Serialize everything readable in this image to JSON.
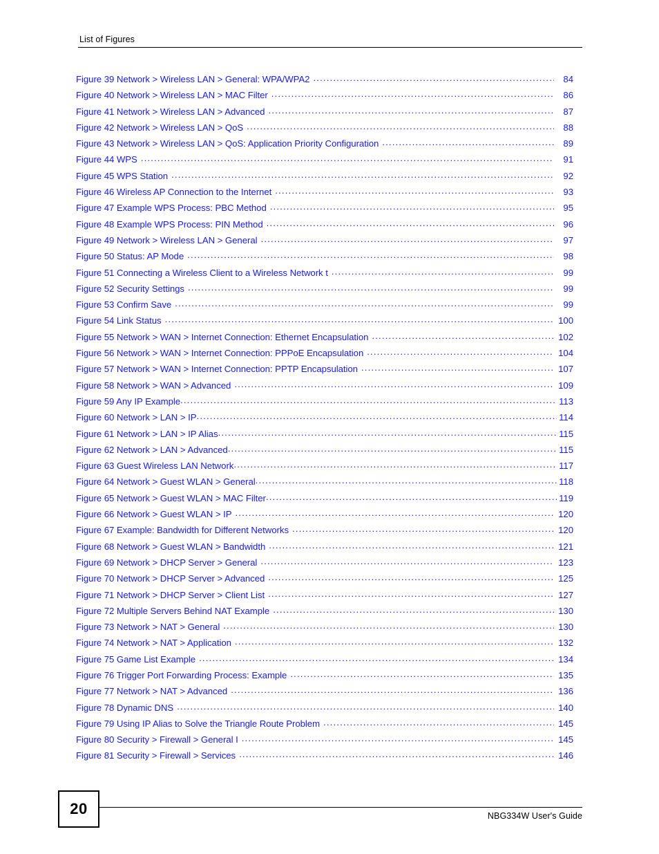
{
  "header": {
    "title": "List of Figures"
  },
  "footer": {
    "page_number": "20",
    "guide_title": "NBG334W User's Guide"
  },
  "colors": {
    "link_blue": "#1a1ae6",
    "text_black": "#000000",
    "background": "#ffffff"
  },
  "toc": {
    "entries": [
      {
        "label": "Figure 39 Network > Wireless LAN > General: WPA/WPA2",
        "page": "84",
        "tight": false
      },
      {
        "label": "Figure 40 Network > Wireless LAN > MAC Filter",
        "page": "86",
        "tight": false
      },
      {
        "label": "Figure 41 Network > Wireless LAN > Advanced",
        "page": "87",
        "tight": false
      },
      {
        "label": "Figure 42 Network > Wireless LAN > QoS",
        "page": "88",
        "tight": false
      },
      {
        "label": "Figure 43 Network > Wireless LAN > QoS: Application Priority Configuration",
        "page": "89",
        "tight": false
      },
      {
        "label": "Figure 44 WPS",
        "page": "91",
        "tight": false
      },
      {
        "label": "Figure 45 WPS Station",
        "page": "92",
        "tight": false
      },
      {
        "label": "Figure 46 Wireless AP Connection to the Internet",
        "page": "93",
        "tight": false
      },
      {
        "label": "Figure 47 Example WPS Process: PBC Method",
        "page": "95",
        "tight": false
      },
      {
        "label": "Figure 48 Example WPS Process: PIN Method",
        "page": "96",
        "tight": false
      },
      {
        "label": "Figure 49 Network > Wireless LAN > General",
        "page": "97",
        "tight": false
      },
      {
        "label": "Figure 50 Status: AP Mode",
        "page": "98",
        "tight": false
      },
      {
        "label": "Figure 51 Connecting a Wireless Client to a Wireless Network t",
        "page": "99",
        "tight": false
      },
      {
        "label": "Figure 52 Security Settings",
        "page": "99",
        "tight": false
      },
      {
        "label": "Figure 53 Confirm Save",
        "page": "99",
        "tight": false
      },
      {
        "label": "Figure 54 Link Status",
        "page": "100",
        "tight": false
      },
      {
        "label": "Figure 55 Network > WAN > Internet Connection: Ethernet Encapsulation",
        "page": "102",
        "tight": false
      },
      {
        "label": "Figure 56 Network > WAN > Internet Connection: PPPoE Encapsulation",
        "page": "104",
        "tight": false
      },
      {
        "label": "Figure 57 Network > WAN > Internet Connection: PPTP Encapsulation",
        "page": "107",
        "tight": false
      },
      {
        "label": "Figure 58 Network > WAN > Advanced",
        "page": "109",
        "tight": false
      },
      {
        "label": "Figure 59 Any IP Example",
        "page": "113",
        "tight": true
      },
      {
        "label": "Figure 60 Network > LAN > IP",
        "page": "114",
        "tight": true
      },
      {
        "label": "Figure 61 Network > LAN > IP Alias",
        "page": "115",
        "tight": true
      },
      {
        "label": "Figure 62 Network > LAN > Advanced",
        "page": "115",
        "tight": true
      },
      {
        "label": "Figure 63 Guest Wireless LAN Network",
        "page": "117",
        "tight": true
      },
      {
        "label": "Figure 64 Network > Guest WLAN > General",
        "page": "118",
        "tight": true
      },
      {
        "label": "Figure 65 Network > Guest WLAN > MAC Filter",
        "page": "119",
        "tight": true
      },
      {
        "label": "Figure 66 Network > Guest WLAN > IP",
        "page": "120",
        "tight": false
      },
      {
        "label": "Figure 67 Example: Bandwidth for Different Networks",
        "page": "120",
        "tight": false
      },
      {
        "label": "Figure 68 Network > Guest WLAN > Bandwidth",
        "page": "121",
        "tight": false
      },
      {
        "label": "Figure 69 Network > DHCP Server > General",
        "page": "123",
        "tight": false
      },
      {
        "label": "Figure 70 Network > DHCP Server > Advanced",
        "page": "125",
        "tight": false
      },
      {
        "label": "Figure 71 Network > DHCP Server > Client List",
        "page": "127",
        "tight": false
      },
      {
        "label": "Figure 72 Multiple Servers Behind NAT Example",
        "page": "130",
        "tight": false
      },
      {
        "label": "Figure 73 Network > NAT > General",
        "page": "130",
        "tight": false
      },
      {
        "label": "Figure 74 Network > NAT > Application",
        "page": "132",
        "tight": false
      },
      {
        "label": "Figure 75 Game List Example",
        "page": "134",
        "tight": false
      },
      {
        "label": "Figure 76 Trigger Port Forwarding Process: Example",
        "page": "135",
        "tight": false
      },
      {
        "label": "Figure 77 Network > NAT > Advanced",
        "page": "136",
        "tight": false
      },
      {
        "label": "Figure 78 Dynamic DNS",
        "page": "140",
        "tight": false
      },
      {
        "label": "Figure 79 Using IP Alias to Solve the Triangle Route Problem",
        "page": "145",
        "tight": false
      },
      {
        "label": "Figure 80 Security > Firewall > General I",
        "page": "145",
        "tight": false
      },
      {
        "label": "Figure 81 Security > Firewall > Services",
        "page": "146",
        "tight": false
      }
    ]
  }
}
